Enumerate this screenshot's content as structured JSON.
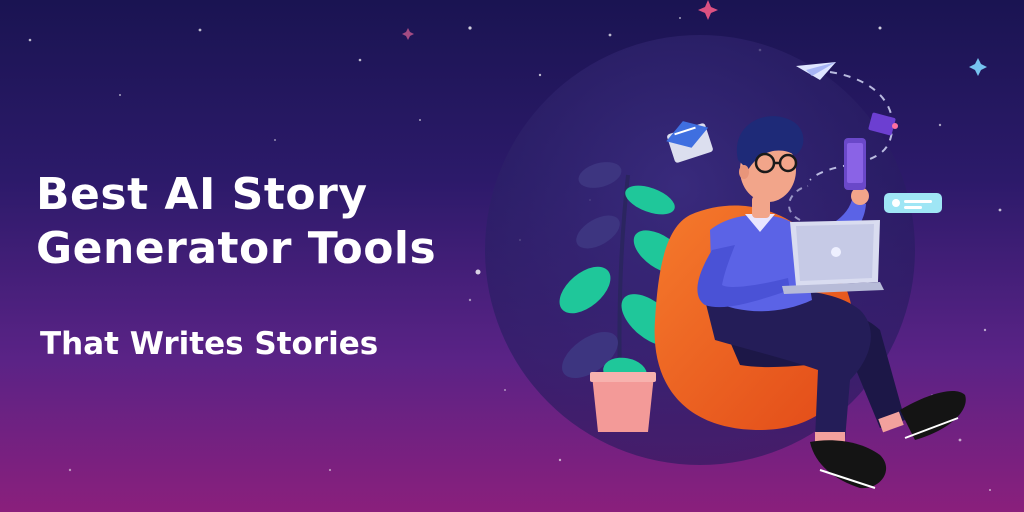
{
  "headline": {
    "line1": "Best AI Story",
    "line2": "Generator Tools"
  },
  "subheadline": "That Writes Stories",
  "colors": {
    "background_top": "#1a1452",
    "background_bottom": "#8a1f7c",
    "text": "#ffffff",
    "beanbag": "#f0641e",
    "shirt": "#5b63e6",
    "pants": "#1c1747",
    "plant": "#1fc79a",
    "pot": "#f39a98"
  },
  "icons": [
    "paper-plane-icon",
    "mail-icon",
    "chat-bubble-icon",
    "phone-icon",
    "laptop-icon"
  ]
}
